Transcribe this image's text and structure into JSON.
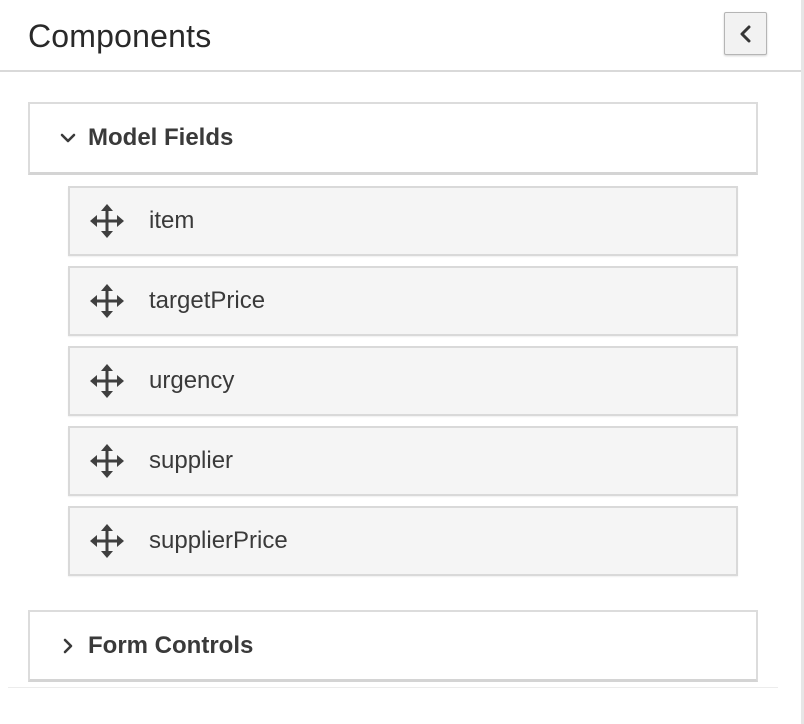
{
  "panel": {
    "title": "Components",
    "collapse_icon": "chevron-left-icon"
  },
  "sections": {
    "model_fields": {
      "label": "Model Fields",
      "expanded": true,
      "chevron_icon": "chevron-down-icon",
      "items": [
        {
          "label": "item",
          "icon": "move-icon"
        },
        {
          "label": "targetPrice",
          "icon": "move-icon"
        },
        {
          "label": "urgency",
          "icon": "move-icon"
        },
        {
          "label": "supplier",
          "icon": "move-icon"
        },
        {
          "label": "supplierPrice",
          "icon": "move-icon"
        }
      ]
    },
    "form_controls": {
      "label": "Form Controls",
      "expanded": false,
      "chevron_icon": "chevron-right-icon"
    }
  },
  "colors": {
    "text": "#363636",
    "border": "#d9d9d9",
    "item_background": "#f5f5f5",
    "button_background": "#f2f2f2"
  }
}
